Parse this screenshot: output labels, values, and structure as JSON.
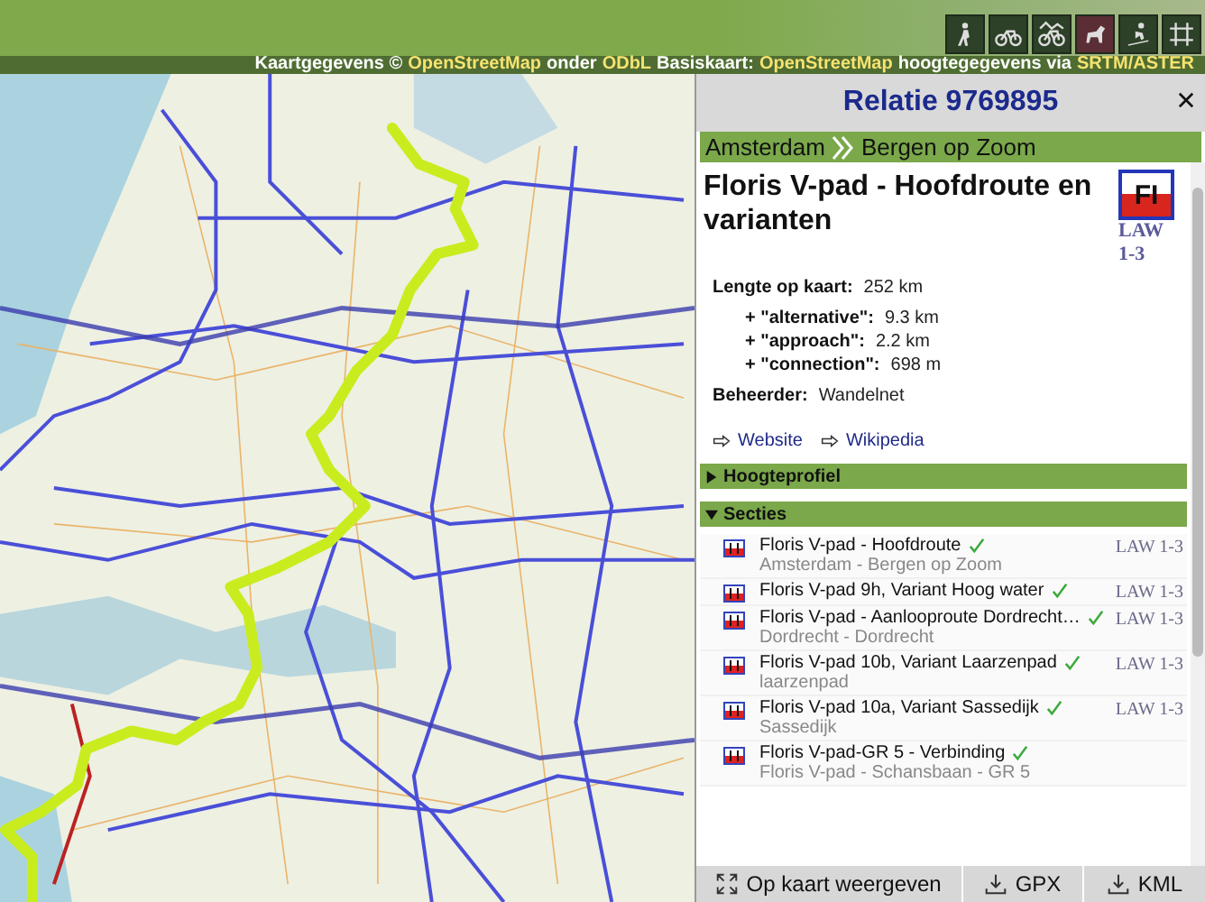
{
  "header": {
    "icons": [
      {
        "kind": "hiker",
        "selected": false
      },
      {
        "kind": "bike",
        "selected": false
      },
      {
        "kind": "mtb",
        "selected": false
      },
      {
        "kind": "horse",
        "selected": true
      },
      {
        "kind": "ski",
        "selected": false
      },
      {
        "kind": "grid",
        "selected": false
      }
    ]
  },
  "attribution": [
    {
      "kind": "text",
      "text": "Kaartgegevens ©"
    },
    {
      "kind": "link",
      "text": "OpenStreetMap"
    },
    {
      "kind": "text",
      "text": "onder"
    },
    {
      "kind": "link",
      "text": "ODbL"
    },
    {
      "kind": "text",
      "text": "Basiskaart:"
    },
    {
      "kind": "link",
      "text": "OpenStreetMap"
    },
    {
      "kind": "text",
      "text": "hoogtegegevens via"
    },
    {
      "kind": "link",
      "text": "SRTM/ASTER"
    }
  ],
  "panel": {
    "title": "Relatie 9769895",
    "breadcrumb": [
      "Amsterdam",
      "Bergen op Zoom"
    ],
    "route_name": "Floris V-pad - Hoofdroute en varianten",
    "logo": {
      "text": "FI",
      "network": "LAW 1-3"
    },
    "length": {
      "label": "Lengte op kaart:",
      "value": "252 km"
    },
    "extras": [
      {
        "label": "+ \"alternative\":",
        "value": "9.3 km"
      },
      {
        "label": "+ \"approach\":",
        "value": "2.2 km"
      },
      {
        "label": "+ \"connection\":",
        "value": "698 m"
      }
    ],
    "operator": {
      "label": "Beheerder:",
      "value": "Wandelnet"
    },
    "links": [
      "Website",
      "Wikipedia"
    ],
    "sections": [
      {
        "title": "Hoogteprofiel",
        "expanded": false
      },
      {
        "title": "Secties",
        "expanded": true
      }
    ],
    "items": [
      {
        "name": "Floris V-pad - Hoofdroute",
        "verified": true,
        "network": "LAW 1-3",
        "subtitle": "Amsterdam - Bergen op Zoom"
      },
      {
        "name": "Floris V-pad 9h, Variant Hoog water",
        "verified": true,
        "network": "LAW 1-3"
      },
      {
        "name": "Floris V-pad - Aanlooproute Dordrecht…",
        "verified": true,
        "network": "LAW 1-3",
        "subtitle": "Dordrecht - Dordrecht"
      },
      {
        "name": "Floris V-pad 10b, Variant Laarzenpad",
        "verified": true,
        "network": "LAW 1-3",
        "subtitle": "laarzenpad"
      },
      {
        "name": "Floris V-pad 10a, Variant Sassedijk",
        "verified": true,
        "network": "LAW 1-3",
        "subtitle": "Sassedijk"
      },
      {
        "name": "Floris V-pad-GR 5 - Verbinding",
        "verified": true,
        "subtitle": "Floris V-pad - Schansbaan - GR 5"
      }
    ],
    "buttons": [
      {
        "kind": "expand",
        "label": "Op kaart weergeven"
      },
      {
        "kind": "download",
        "label": "GPX"
      },
      {
        "kind": "download",
        "label": "KML"
      }
    ]
  }
}
